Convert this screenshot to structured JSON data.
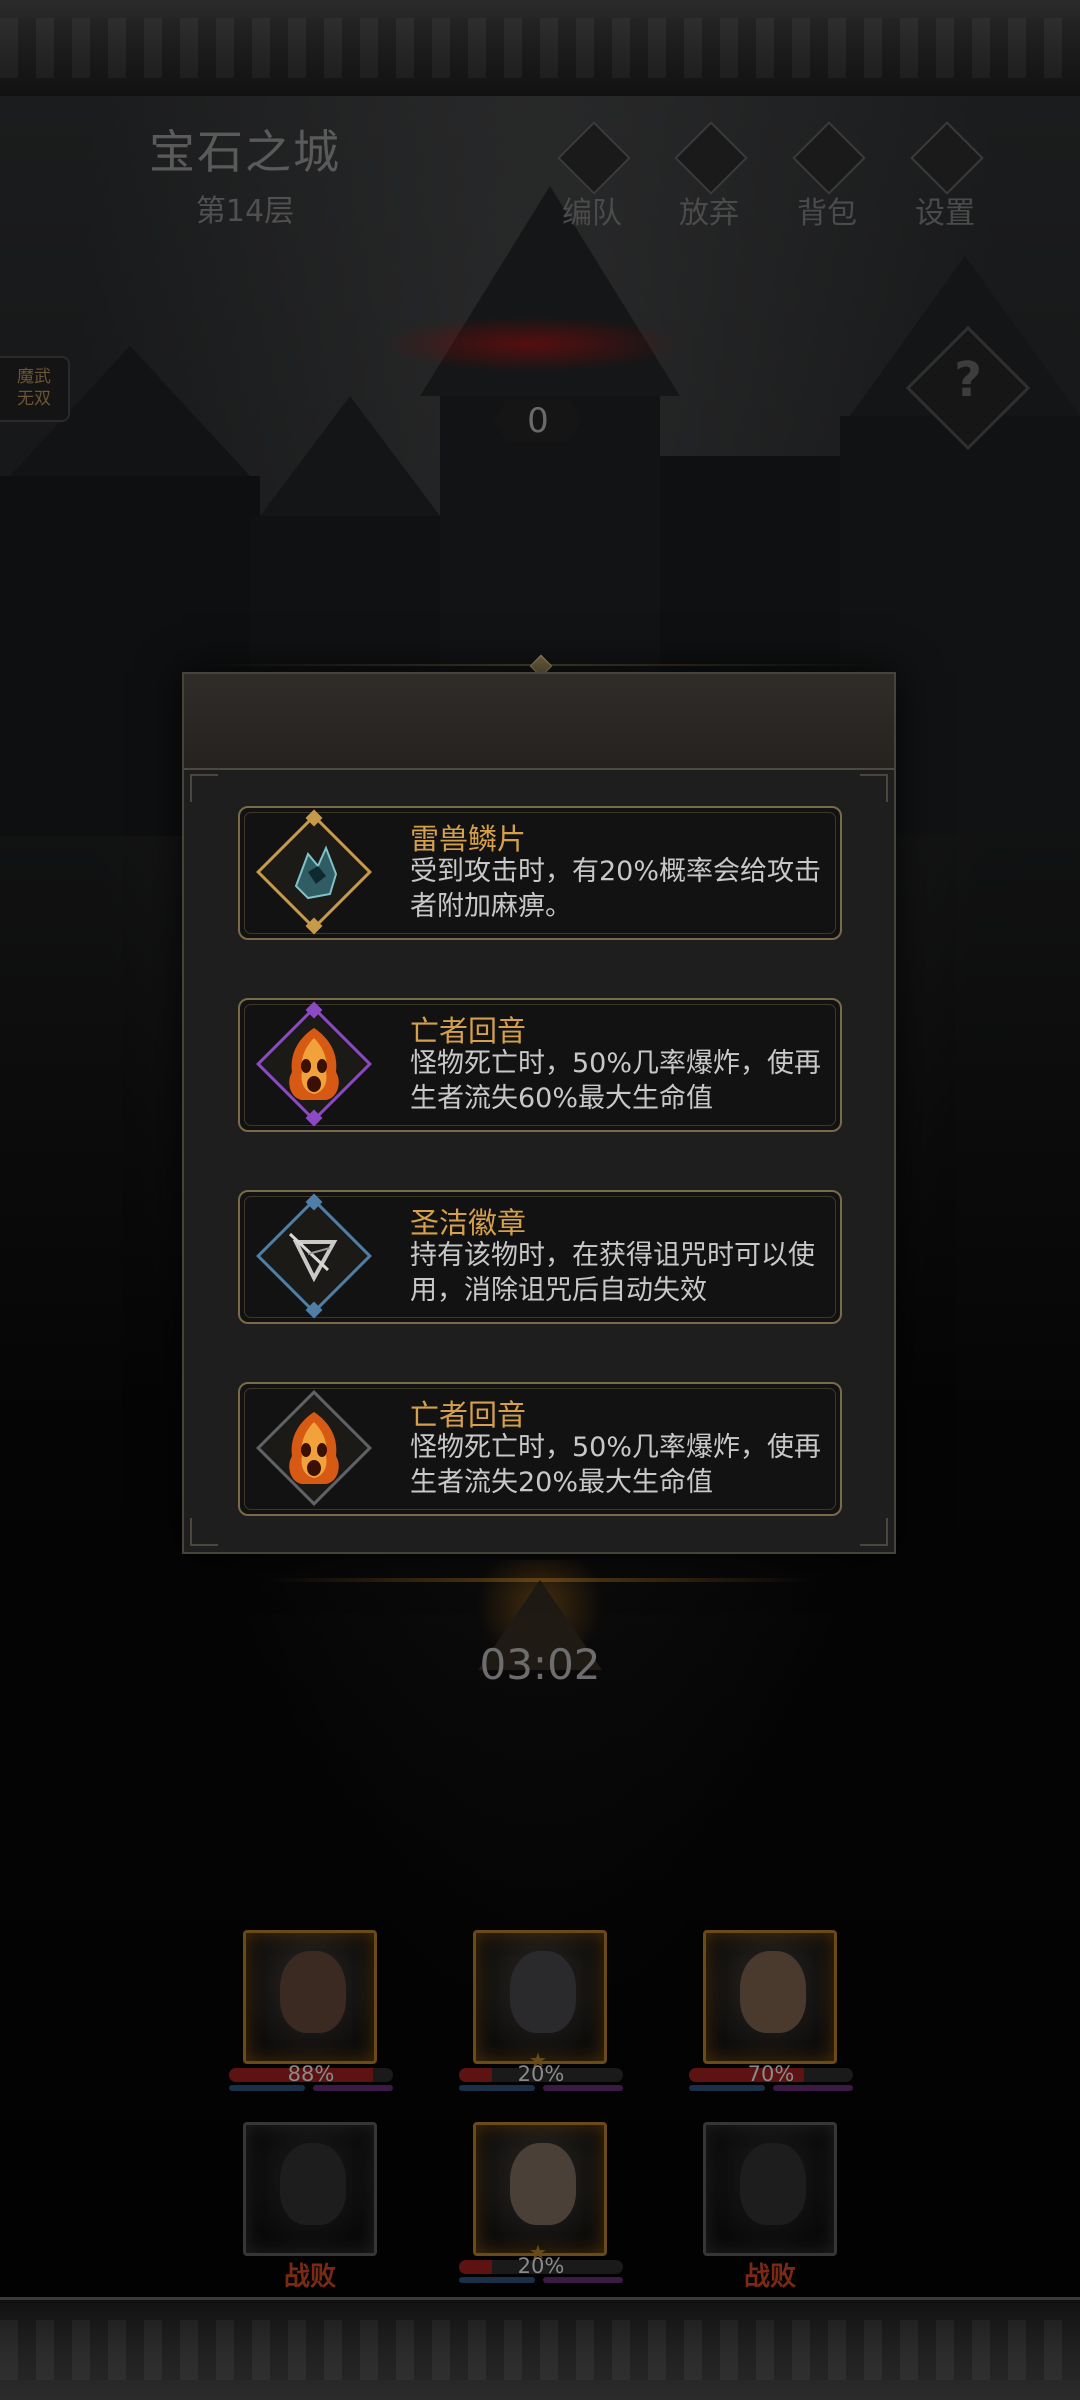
{
  "header": {
    "city_title": "宝石之城",
    "floor": "第14层",
    "buttons": [
      {
        "label": "编队",
        "icon": "team-icon"
      },
      {
        "label": "放弃",
        "icon": "door-icon"
      },
      {
        "label": "背包",
        "icon": "backpack-icon"
      },
      {
        "label": "设置",
        "icon": "settings-icon"
      }
    ],
    "side_badge": "魔武\n无双",
    "help_glyph": "?",
    "counter": "0"
  },
  "dialog": {
    "items": [
      {
        "title": "雷兽鳞片",
        "desc": "受到攻击时，有20%概率会给攻击者附加麻痹。",
        "icon": "scale-icon",
        "rarity_color": "#c79a4a"
      },
      {
        "title": "亡者回音",
        "desc": "怪物死亡时，50%几率爆炸，使再生者流失60%最大生命值",
        "icon": "ghost-flame-icon",
        "rarity_color": "#8b4ac4"
      },
      {
        "title": "圣洁徽章",
        "desc": "持有该物时，在获得诅咒时可以使用，消除诅咒后自动失效",
        "icon": "holy-badge-icon",
        "rarity_color": "#4f7ea8"
      },
      {
        "title": "亡者回音",
        "desc": "怪物死亡时，50%几率爆炸，使再生者流失20%最大生命值",
        "icon": "ghost-flame-icon",
        "rarity_color": "#5f6368"
      }
    ]
  },
  "timer": "03:02",
  "heroes": [
    {
      "hp_text": "88%",
      "hp": 0.88,
      "state": "alive"
    },
    {
      "hp_text": "20%",
      "hp": 0.2,
      "state": "alive"
    },
    {
      "hp_text": "70%",
      "hp": 0.7,
      "state": "alive"
    },
    {
      "hp_text": "",
      "hp": 0,
      "state": "defeated",
      "status_text": "战败"
    },
    {
      "hp_text": "20%",
      "hp": 0.2,
      "state": "alive"
    },
    {
      "hp_text": "",
      "hp": 0,
      "state": "defeated",
      "status_text": "战败"
    }
  ],
  "colors": {
    "gold": "#d5a049",
    "hp_red": "#5e1313",
    "defeat_red": "#7a2a14"
  }
}
